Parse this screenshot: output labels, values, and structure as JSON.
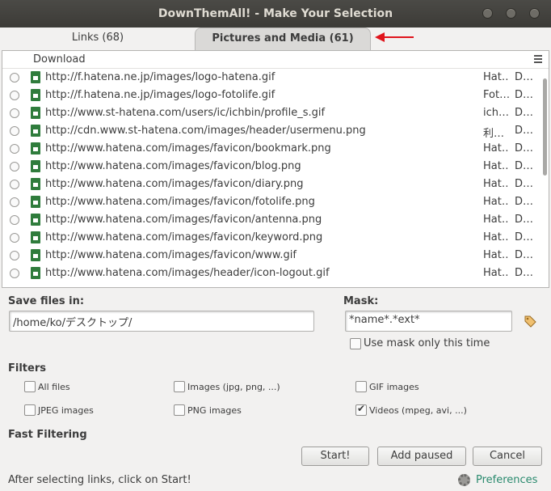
{
  "window": {
    "title": "DownThemAll! - Make Your Selection"
  },
  "tabs": [
    {
      "label": "Links (68)"
    },
    {
      "label": "Pictures and Media (61)"
    }
  ],
  "list": {
    "column": "Download",
    "rows": [
      {
        "url": "http://f.hatena.ne.jp/images/logo-hatena.gif",
        "c2": "Hat…",
        "c3": "D…"
      },
      {
        "url": "http://f.hatena.ne.jp/images/logo-fotolife.gif",
        "c2": "Fot…",
        "c3": "D…"
      },
      {
        "url": "http://www.st-hatena.com/users/ic/ichbin/profile_s.gif",
        "c2": "ich…",
        "c3": "D…"
      },
      {
        "url": "http://cdn.www.st-hatena.com/images/header/usermenu.png",
        "c2": "利…",
        "c3": "D…"
      },
      {
        "url": "http://www.hatena.com/images/favicon/bookmark.png",
        "c2": "Hat…",
        "c3": "D…"
      },
      {
        "url": "http://www.hatena.com/images/favicon/blog.png",
        "c2": "Hat…",
        "c3": "D…"
      },
      {
        "url": "http://www.hatena.com/images/favicon/diary.png",
        "c2": "Hat…",
        "c3": "D…"
      },
      {
        "url": "http://www.hatena.com/images/favicon/fotolife.png",
        "c2": "Hat…",
        "c3": "D…"
      },
      {
        "url": "http://www.hatena.com/images/favicon/antenna.png",
        "c2": "Hat…",
        "c3": "D…"
      },
      {
        "url": "http://www.hatena.com/images/favicon/keyword.png",
        "c2": "Hat…",
        "c3": "D…"
      },
      {
        "url": "http://www.hatena.com/images/favicon/www.gif",
        "c2": "Hat…",
        "c3": "D…"
      },
      {
        "url": "http://www.hatena.com/images/header/icon-logout.gif",
        "c2": "Hat…",
        "c3": "D…"
      }
    ]
  },
  "save": {
    "label": "Save files in:",
    "value": "/home/ko/デスクトップ/"
  },
  "mask": {
    "label": "Mask:",
    "value": "*name*.*ext*",
    "once_label": "Use mask only this time"
  },
  "filters": {
    "heading": "Filters",
    "all_files": "All files",
    "images": "Images (jpg, png, ...)",
    "gif": "GIF images",
    "jpeg": "JPEG images",
    "png": "PNG images",
    "videos": "Videos (mpeg, avi, ...)"
  },
  "fast_filtering": "Fast Filtering",
  "buttons": {
    "start": "Start!",
    "add_paused": "Add paused",
    "cancel": "Cancel"
  },
  "status": "After selecting links, click on Start!",
  "preferences": "Preferences",
  "colors": {
    "accent": "#2a8a6e",
    "arrow": "#e0141c",
    "titlebar": "#3c3b37"
  }
}
